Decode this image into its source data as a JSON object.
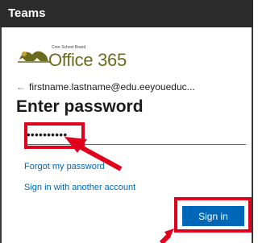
{
  "window": {
    "title": "Teams"
  },
  "logo": {
    "org_name": "Cree School Board",
    "product_name": "Office 365",
    "icon": "office365-logo-icon"
  },
  "account": {
    "back_icon": "back-arrow-icon",
    "email": "firstname.lastname@edu.eeyoueduc..."
  },
  "form": {
    "heading": "Enter password",
    "password_value": "••••••••••",
    "forgot_link": "Forgot my password",
    "another_account_link": "Sign in with another account",
    "signin_label": "Sign in"
  },
  "annotations": {
    "highlight_color": "#e0001b",
    "accent_color": "#0067b8"
  }
}
